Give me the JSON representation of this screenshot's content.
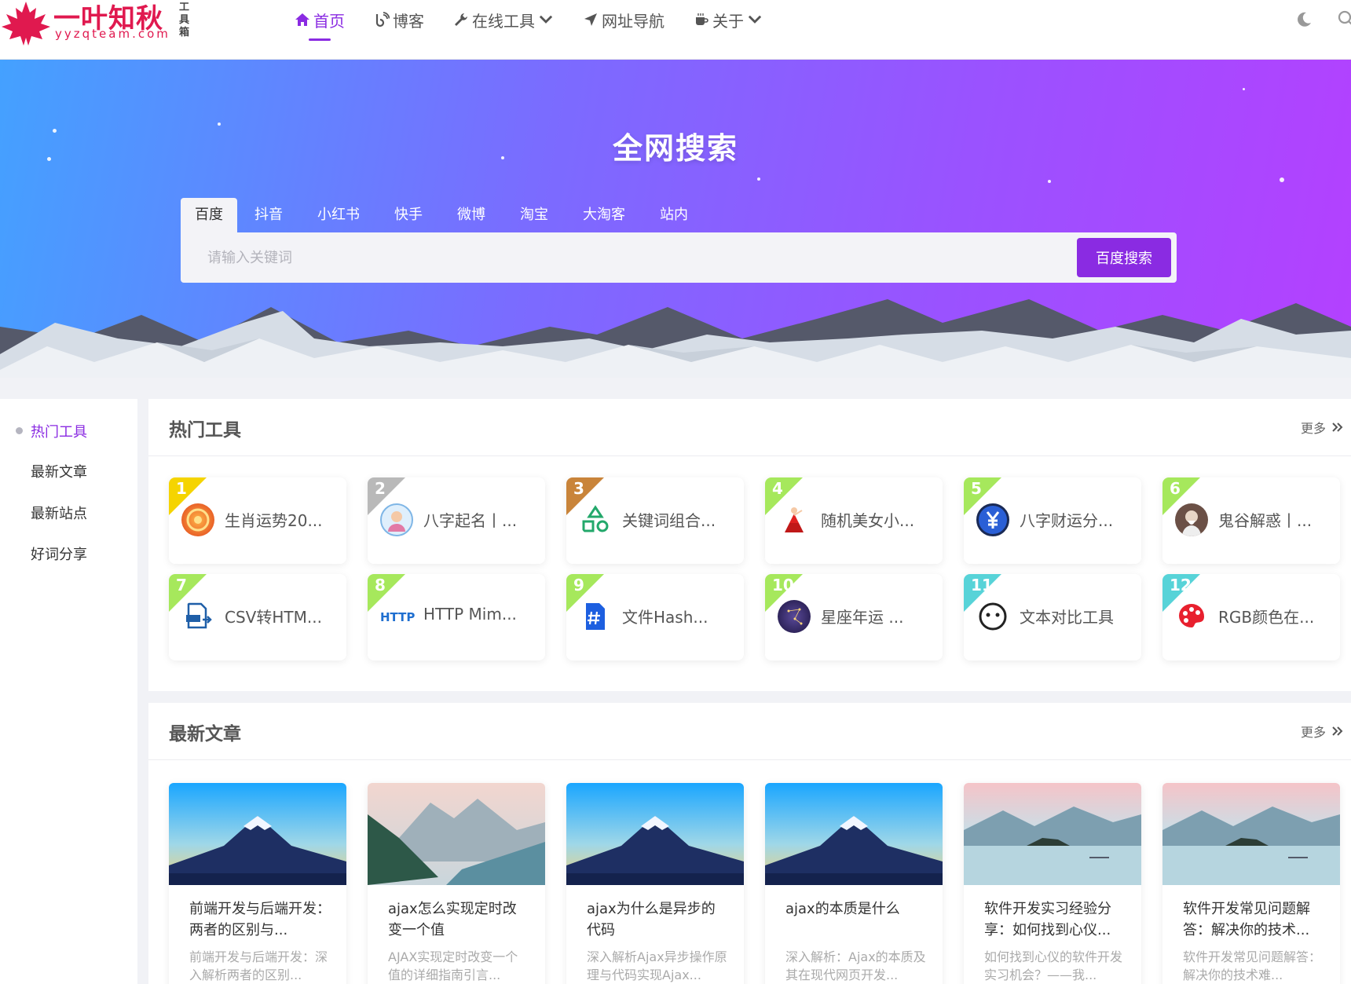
{
  "header": {
    "logo_title": "一叶知秋",
    "logo_sub": "yyzqteam.com",
    "logo_tag": "工具箱",
    "nav": [
      {
        "label": "首页",
        "active": true,
        "icon": "home-icon"
      },
      {
        "label": "博客",
        "icon": "blog-icon"
      },
      {
        "label": "在线工具",
        "icon": "wrench-icon",
        "dropdown": true
      },
      {
        "label": "网址导航",
        "icon": "send-icon"
      },
      {
        "label": "关于",
        "icon": "coffee-icon",
        "dropdown": true
      }
    ]
  },
  "banner": {
    "title": "全网搜索",
    "tabs": [
      "百度",
      "抖音",
      "小红书",
      "快手",
      "微博",
      "淘宝",
      "大淘客",
      "站内"
    ],
    "search_placeholder": "请输入关键词",
    "search_button": "百度搜索"
  },
  "sidebar": {
    "items": [
      "热门工具",
      "最新文章",
      "最新站点",
      "好词分享"
    ]
  },
  "hot_tools": {
    "title": "热门工具",
    "more": "更多",
    "items": [
      {
        "rank": "1",
        "name": "生肖运势20..."
      },
      {
        "rank": "2",
        "name": "八字起名丨..."
      },
      {
        "rank": "3",
        "name": "关键词组合..."
      },
      {
        "rank": "4",
        "name": "随机美女小..."
      },
      {
        "rank": "5",
        "name": "八字财运分..."
      },
      {
        "rank": "6",
        "name": "鬼谷解惑丨..."
      },
      {
        "rank": "7",
        "name": "CSV转HTM..."
      },
      {
        "rank": "8",
        "name": "HTTP Mim..."
      },
      {
        "rank": "9",
        "name": "文件Hash..."
      },
      {
        "rank": "10",
        "name": "星座年运 ..."
      },
      {
        "rank": "11",
        "name": "文本对比工具"
      },
      {
        "rank": "12",
        "name": "RGB颜色在..."
      }
    ]
  },
  "latest_articles": {
    "title": "最新文章",
    "more": "更多",
    "items": [
      {
        "title": "前端开发与后端开发：两者的区别与...",
        "desc": "前端开发与后端开发：深入解析两者的区别..."
      },
      {
        "title": "ajax怎么实现定时改变一个值",
        "desc": "AJAX实现定时改变一个值的详细指南引言..."
      },
      {
        "title": "ajax为什么是异步的代码",
        "desc": "深入解析Ajax异步操作原理与代码实现Ajax..."
      },
      {
        "title": "ajax的本质是什么",
        "desc": "深入解析：Ajax的本质及其在现代网页开发..."
      },
      {
        "title": "软件开发实习经验分享：如何找到心仪...",
        "desc": "如何找到心仪的软件开发实习机会？——我..."
      },
      {
        "title": "软件开发常见问题解答：解决你的技术...",
        "desc": "软件开发常见问题解答：解决你的技术难..."
      }
    ]
  },
  "colors": {
    "accent": "#8a2be2",
    "rank_yellow": "#f5d400",
    "rank_silver": "#b9b9b9",
    "rank_bronze": "#c9843a",
    "rank_green": "#a6e85c",
    "rank_cyan": "#57d3d8"
  }
}
